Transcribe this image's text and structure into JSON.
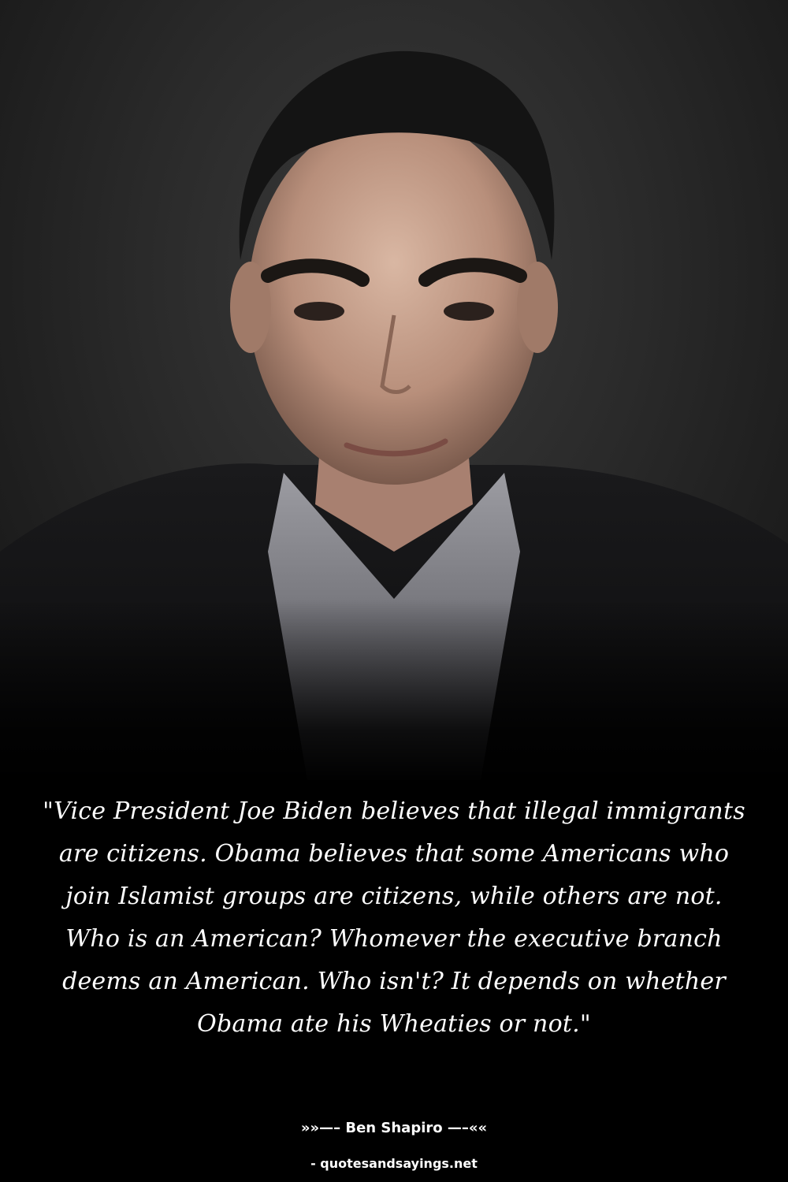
{
  "quote": {
    "text": "\"Vice President Joe Biden believes that illegal immigrants are citizens. Obama believes that some Americans who join Islamist groups are citizens, while others are not. Who is an American? Whomever the executive branch deems an American. Who isn't? It depends on whether Obama ate his Wheaties or not.\""
  },
  "attribution": {
    "text": "»»—– Ben Shapiro —–««"
  },
  "source": {
    "text": "- quotesandsayings.net"
  },
  "colors": {
    "background": "#000000",
    "text": "#ffffff",
    "photo_backdrop": "#2a2a2a"
  }
}
